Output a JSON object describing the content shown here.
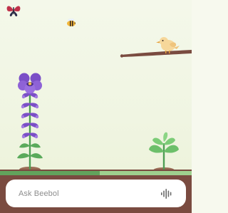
{
  "assistant": {
    "placeholder": "Ask Beebol",
    "voice_icon": "voice-waveform-icon"
  },
  "scene": {
    "elements": [
      "butterfly",
      "bee",
      "bird-on-branch",
      "flowering-plant",
      "seedling"
    ],
    "colors": {
      "sky": "#f4f8ea",
      "soil": "#7a4b40",
      "grass_dark": "#62a35c",
      "grass_light": "#9fd08e",
      "flower_purple": "#7b4fc7",
      "leaf_green": "#4e9e54",
      "bird_yellow": "#f6d79a"
    }
  }
}
